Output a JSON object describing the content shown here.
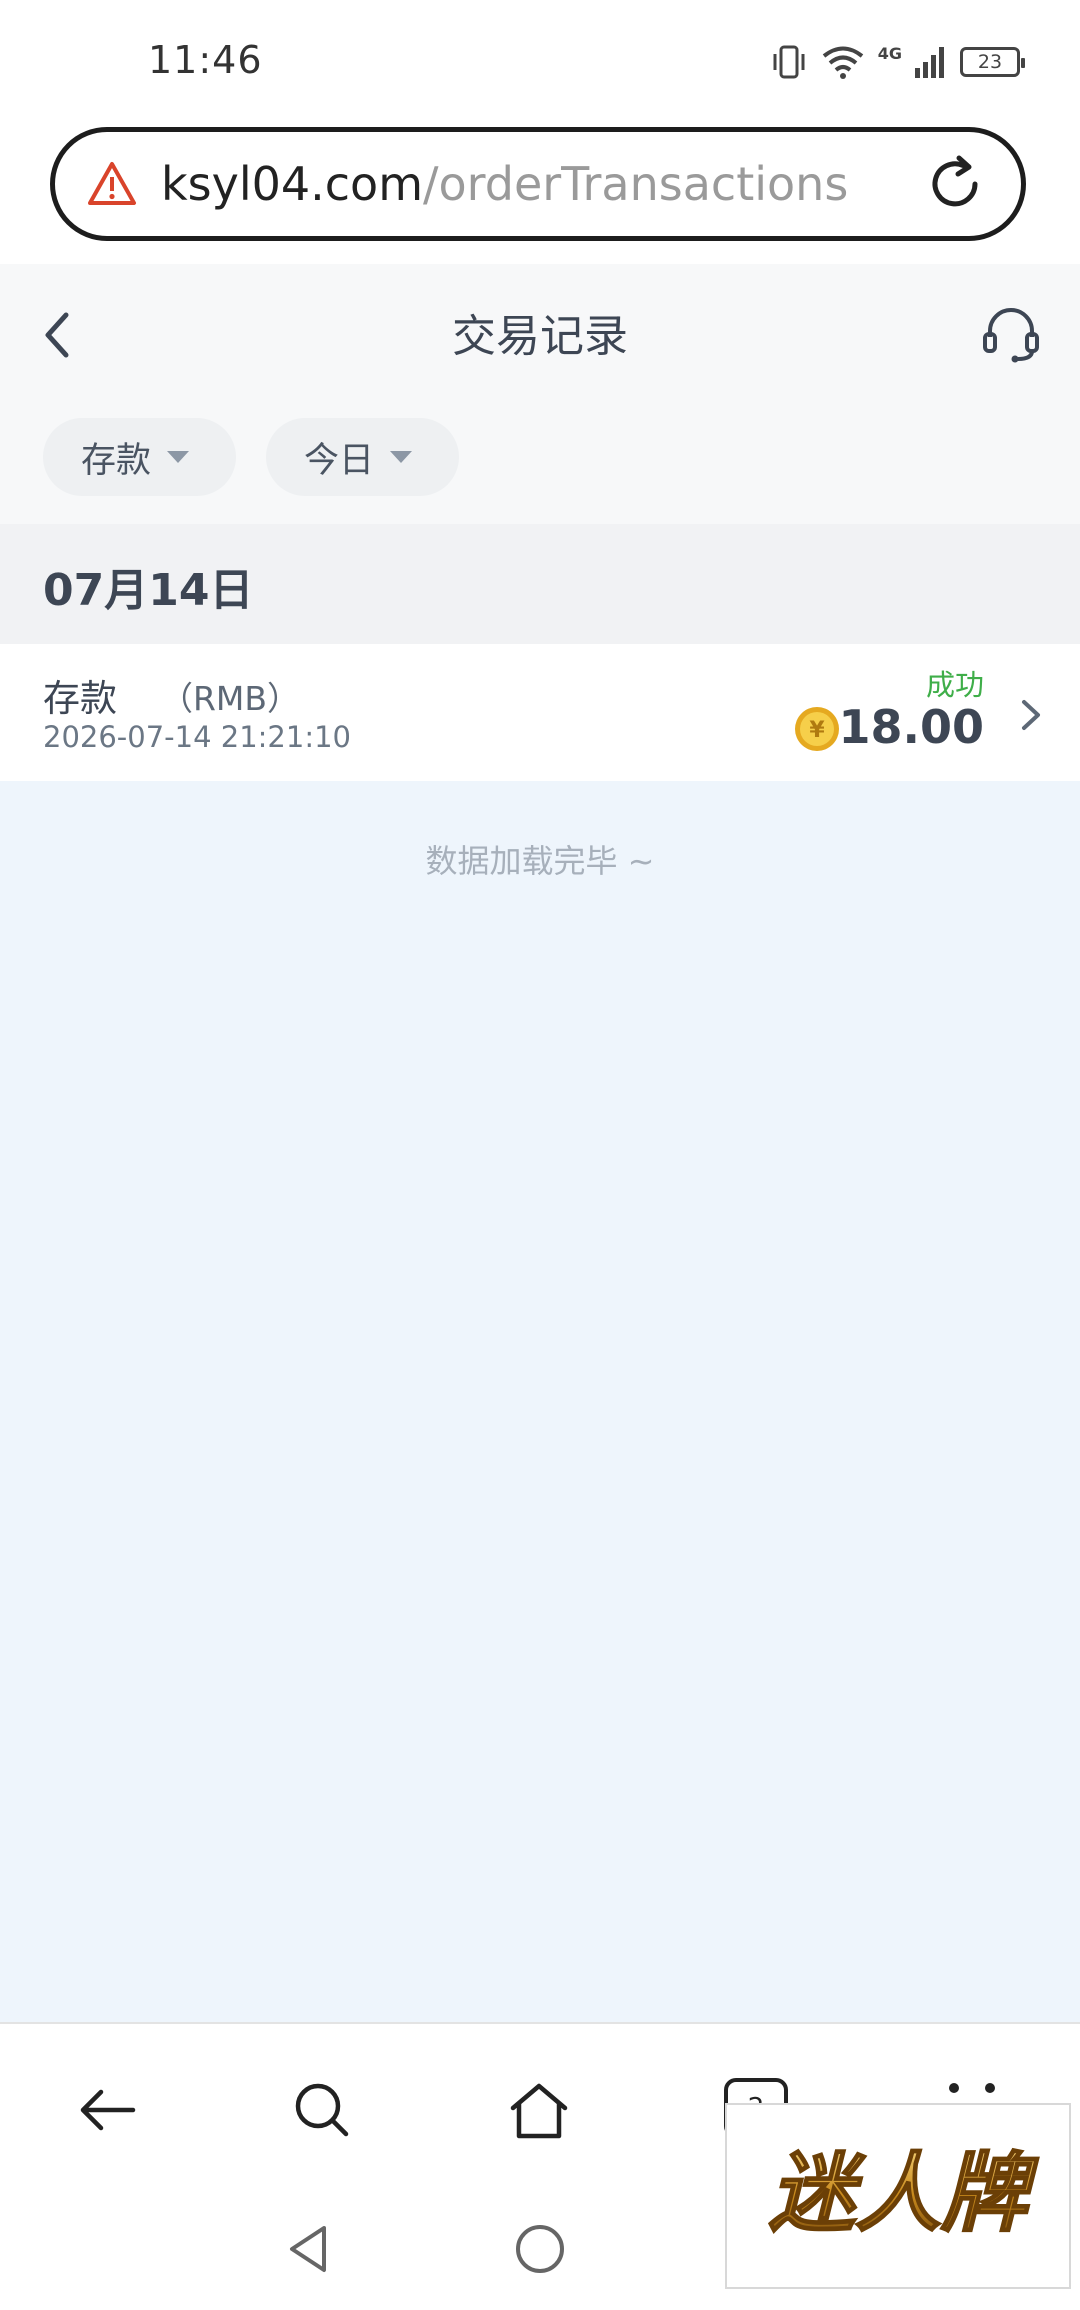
{
  "status_bar": {
    "time": "11:46",
    "network_label": "4G",
    "battery": "23",
    "icons": [
      "vibrate-icon",
      "wifi-icon",
      "signal-icon",
      "battery-icon"
    ]
  },
  "browser": {
    "url_host": "ksyl04.com",
    "url_path": "/orderTransactions",
    "security_icon": "warning-icon",
    "reload_icon": "reload-icon"
  },
  "header": {
    "title": "交易记录",
    "back_icon": "chevron-left-icon",
    "support_icon": "headset-icon"
  },
  "filters": {
    "type_label": "存款",
    "date_label": "今日"
  },
  "groups": [
    {
      "date": "07月14日",
      "items": [
        {
          "type": "存款",
          "currency": "（RMB）",
          "time": "2026-07-14 21:21:10",
          "status": "成功",
          "amount": "18.00",
          "coin_symbol": "¥"
        }
      ]
    }
  ],
  "footer_text": "数据加载完毕 ~",
  "toolbar": {
    "items": [
      "back-arrow-icon",
      "search-icon",
      "home-icon",
      "tabs-icon",
      "more-icon"
    ],
    "tabs_count": "2"
  },
  "system_nav": [
    "nav-back-icon",
    "nav-home-icon"
  ],
  "watermark": {
    "text": "迷人牌"
  },
  "colors": {
    "success": "#3fae49",
    "coin": "#f1c232",
    "content_bg": "#eef5fc"
  }
}
